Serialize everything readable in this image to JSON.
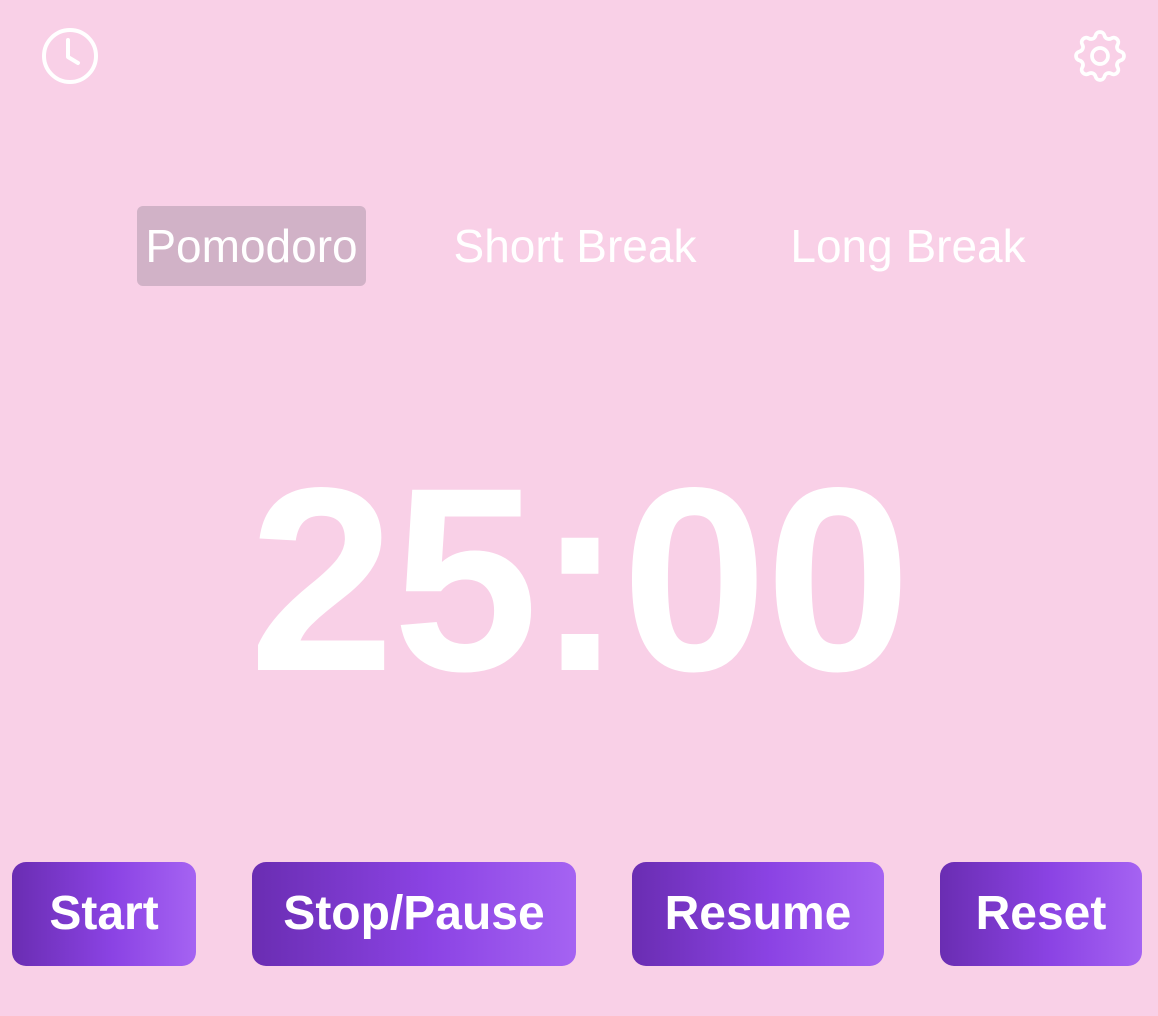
{
  "header": {
    "left_icon": "clock-icon",
    "right_icon": "gear-icon"
  },
  "tabs": [
    {
      "label": "Pomodoro",
      "active": true
    },
    {
      "label": "Short Break",
      "active": false
    },
    {
      "label": "Long Break",
      "active": false
    }
  ],
  "timer": {
    "display": "25:00"
  },
  "controls": {
    "start_label": "Start",
    "stop_label": "Stop/Pause",
    "resume_label": "Resume",
    "reset_label": "Reset"
  },
  "colors": {
    "background": "#f9d0e7",
    "active_tab": "#d1b2c7",
    "button_gradient_start": "#6a2db2",
    "button_gradient_end": "#a563f2",
    "text": "#ffffff"
  }
}
